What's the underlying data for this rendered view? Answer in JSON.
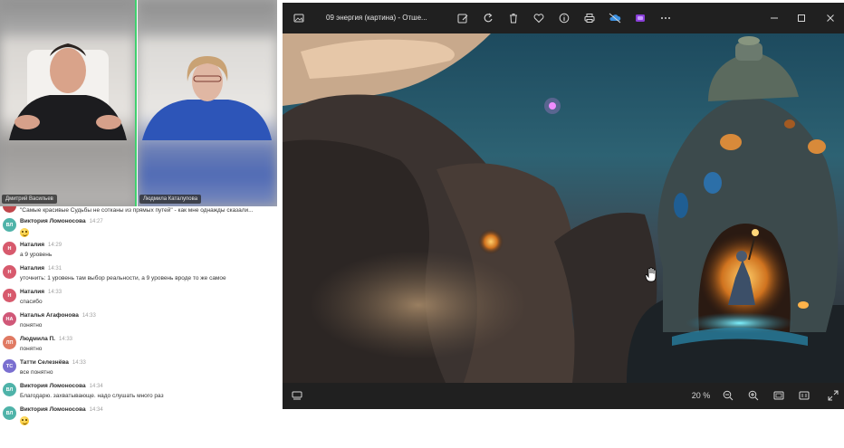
{
  "video": {
    "participants": [
      {
        "name": "Дмитрий Васильев"
      },
      {
        "name": "Людмила Каталупова"
      }
    ]
  },
  "chat": {
    "messages": [
      {
        "author": "",
        "time": "",
        "text": "\"Самые красивые Судьбы не сотканы из прямых путей\" - как мне однажды сказали...",
        "avatar_text": "",
        "avatar_color": "#c0464b"
      },
      {
        "author": "Виктория Ломоносова",
        "time": "14:27",
        "text": "",
        "emoji": "smile",
        "avatar_text": "ВЛ",
        "avatar_color": "#4fb3a9"
      },
      {
        "author": "Наталия",
        "time": "14:29",
        "text": "а 9 уровень",
        "avatar_text": "Н",
        "avatar_color": "#d75a6d"
      },
      {
        "author": "Наталия",
        "time": "14:31",
        "text": "уточнить: 1 уровень там выбор реальности, а 9 уровень вроде то же самое",
        "avatar_text": "Н",
        "avatar_color": "#d75a6d"
      },
      {
        "author": "Наталия",
        "time": "14:33",
        "text": "спасибо",
        "avatar_text": "Н",
        "avatar_color": "#d75a6d"
      },
      {
        "author": "Наталья Агафонова",
        "time": "14:33",
        "text": "понятно",
        "avatar_text": "НА",
        "avatar_color": "#d05878"
      },
      {
        "author": "Людмила П.",
        "time": "14:33",
        "text": "понятно",
        "avatar_text": "ЛП",
        "avatar_color": "#e07a63"
      },
      {
        "author": "Татти Селезнёва",
        "time": "14:33",
        "text": "все понятно",
        "avatar_text": "ТС",
        "avatar_color": "#7a6fd0"
      },
      {
        "author": "Виктория Ломоносова",
        "time": "14:34",
        "text": "Благодарю. захватывающе. надо слушать много раз",
        "avatar_text": "ВЛ",
        "avatar_color": "#4fb3a9"
      },
      {
        "author": "Виктория Ломоносова",
        "time": "14:34",
        "text": "",
        "emoji": "laugh",
        "avatar_text": "ВЛ",
        "avatar_color": "#4fb3a9"
      }
    ]
  },
  "photos": {
    "title": "09 энергия (картина) - Отше...",
    "zoom": "20 %",
    "icons": {
      "app": "photos-app-icon",
      "edit": "edit-image-icon",
      "rotate": "rotate-icon",
      "delete": "delete-icon",
      "favorite": "heart-icon",
      "info": "info-icon",
      "print": "print-icon",
      "onedrive": "cloud-icon",
      "clipchamp": "clipchamp-icon",
      "more": "more-icon",
      "minimize": "minimize-icon",
      "maximize": "maximize-icon",
      "close": "close-icon",
      "filmstrip": "filmstrip-icon",
      "zoom_out": "zoom-out-icon",
      "zoom_in": "zoom-in-icon",
      "fit": "fit-to-window-icon",
      "actual_size": "actual-size-icon",
      "fullscreen": "fullscreen-icon"
    }
  }
}
